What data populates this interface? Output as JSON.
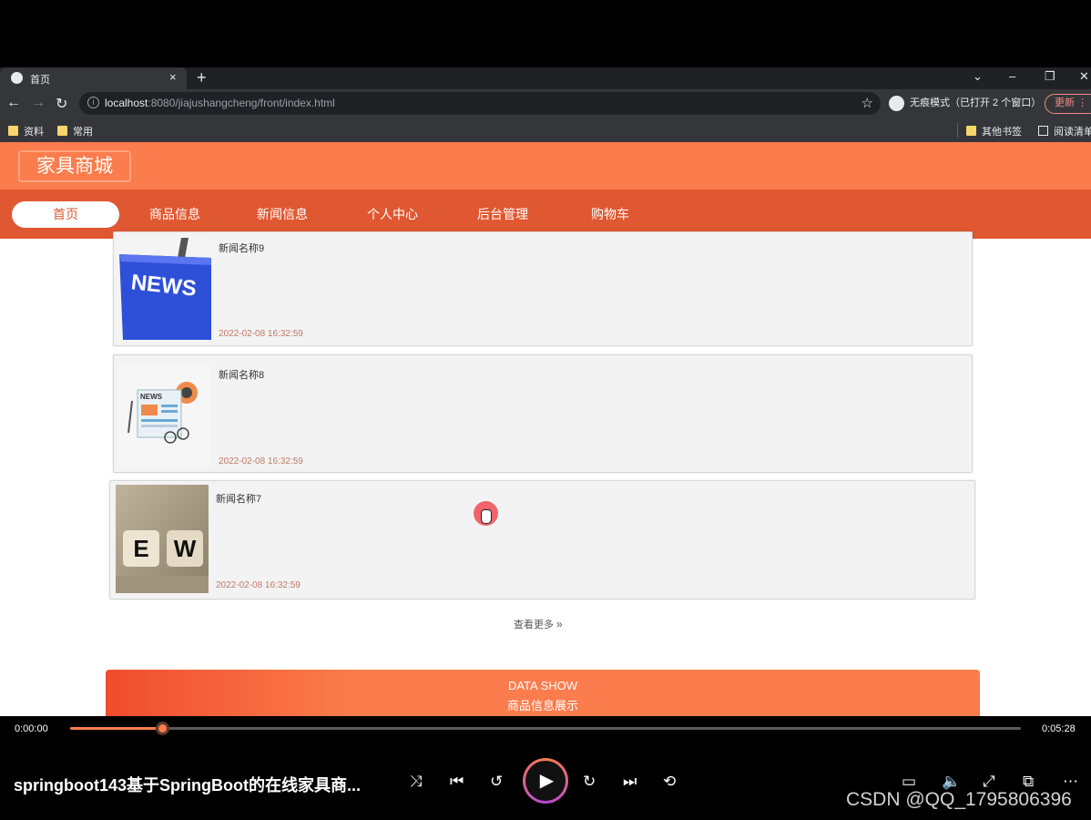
{
  "browser": {
    "tab_title": "首页",
    "tab_close": "×",
    "new_tab": "+",
    "url_host": "localhost",
    "url_path": ":8080/jiajushangcheng/front/index.html",
    "incognito_label": "无痕模式（已打开 2 个窗口）",
    "update_label": "更新",
    "bookmarks": [
      "资料",
      "常用"
    ],
    "other_bookmarks": "其他书签",
    "reading_list": "阅读清单"
  },
  "site": {
    "logo": "家具商城",
    "nav": [
      "首页",
      "商品信息",
      "新闻信息",
      "个人中心",
      "后台管理",
      "购物车"
    ],
    "news": [
      {
        "title": "新闻名称9",
        "date": "2022-02-08 16:32:59"
      },
      {
        "title": "新闻名称8",
        "date": "2022-02-08 16:32:59"
      },
      {
        "title": "新闻名称7",
        "date": "2022-02-08 16:32:59"
      }
    ],
    "thumb_text": {
      "news_key": "NEWS",
      "news_small": "NEWS",
      "dice": [
        "E",
        "W"
      ]
    },
    "more_label": "查看更多",
    "data_show_en": "DATA SHOW",
    "data_show_cn": "商品信息展示"
  },
  "player": {
    "time_current": "0:00:00",
    "time_total": "0:05:28",
    "progress": 0.097,
    "title": "springboot143基于SpringBoot的在线家具商...",
    "watermark": "CSDN @QQ_1795806396"
  },
  "colors": {
    "header": "#fb7c4c",
    "nav": "#e05831",
    "accent": "#fb7c4c"
  }
}
